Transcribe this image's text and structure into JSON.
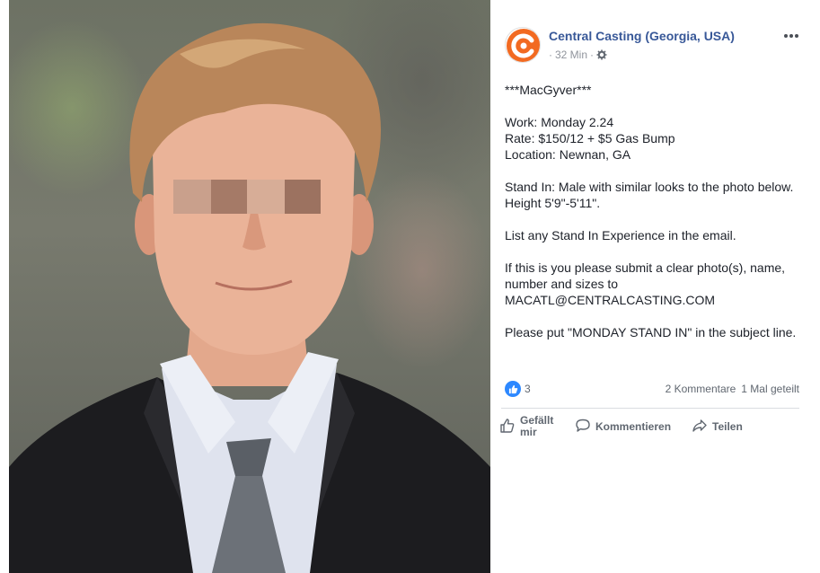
{
  "post": {
    "page_name": "Central Casting (Georgia, USA)",
    "time": "32 Min",
    "separator": "·",
    "avatar_icon": "central-casting-logo",
    "more_icon": "more-options-icon",
    "text_lines": [
      "***MacGyver***",
      "",
      "Work: Monday 2.24",
      "Rate: $150/12 + $5 Gas Bump",
      "Location: Newnan, GA",
      "",
      "Stand In: Male with similar looks to the photo below.",
      "Height 5'9\"-5'11\".",
      "",
      "List any Stand In Experience in the email.",
      "",
      "If this is you please submit a clear photo(s), name,",
      "number and sizes to",
      "MACATL@CENTRALCASTING.COM",
      "",
      "Please put \"MONDAY STAND IN\" in the subject line."
    ],
    "reaction_count": "3",
    "comments": "2 Kommentare",
    "shares": "1 Mal geteilt",
    "actions": {
      "like_line1": "Gefällt",
      "like_line2": "mir",
      "comment": "Kommentieren",
      "share": "Teilen"
    }
  },
  "colors": {
    "link": "#385898",
    "brand_orange": "#f26a21",
    "like_blue": "#2d88ff",
    "muted": "#606770"
  }
}
